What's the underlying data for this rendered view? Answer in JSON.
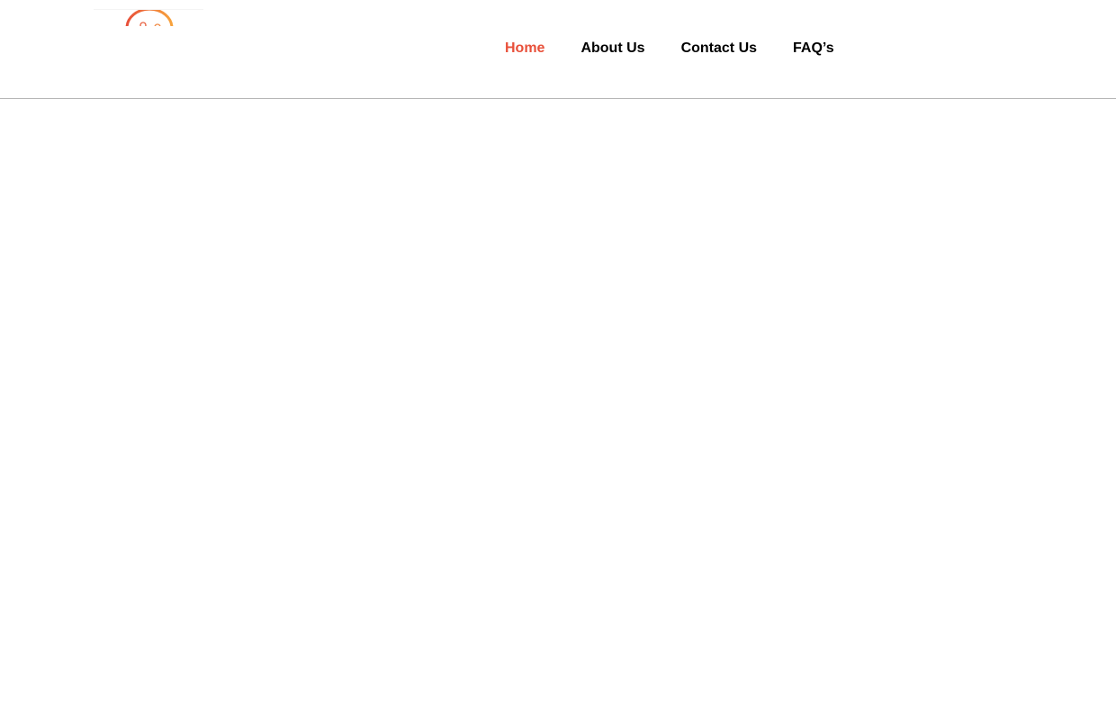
{
  "header": {
    "logo": {
      "icon": "sun-arc-logo-icon",
      "gradient_start": "#e8503a",
      "gradient_end": "#f7a33c"
    },
    "nav": {
      "items": [
        {
          "label": "Home",
          "active": true
        },
        {
          "label": "About Us",
          "active": false
        },
        {
          "label": "Contact Us",
          "active": false
        },
        {
          "label": "FAQ’s",
          "active": false
        }
      ],
      "active_color": "#e8503a",
      "text_color": "#000000"
    }
  },
  "main": {}
}
